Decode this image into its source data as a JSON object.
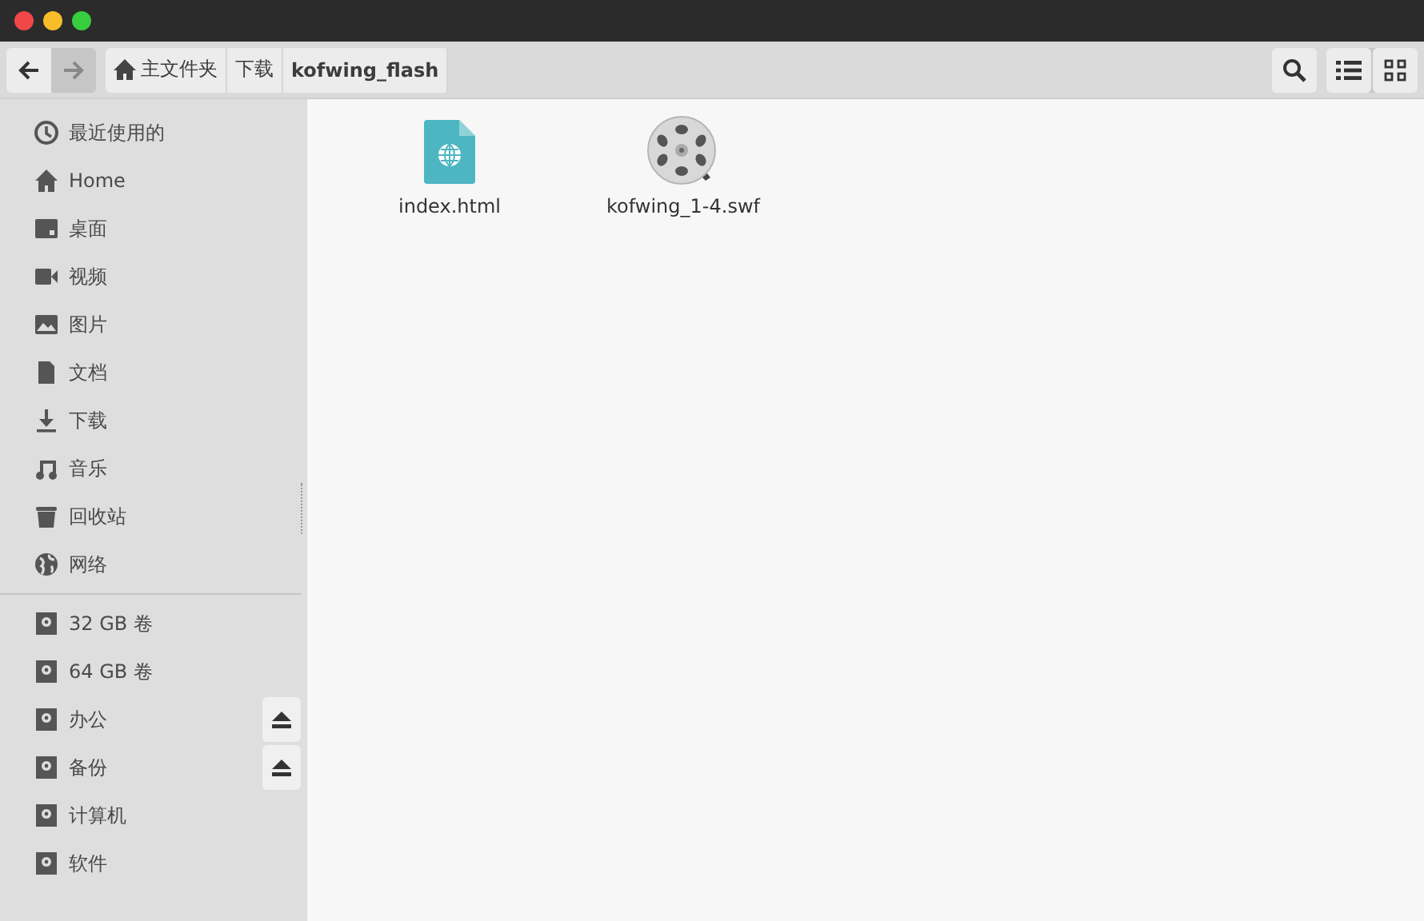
{
  "navigation": {
    "back": {
      "disabled": false
    },
    "forward": {
      "disabled": true
    }
  },
  "path": [
    {
      "label": "主文件夹",
      "kind": "home",
      "selected": false
    },
    {
      "label": "下载",
      "kind": "folder",
      "selected": false
    },
    {
      "label": "kofwing_flash",
      "kind": "folder",
      "selected": true
    }
  ],
  "sidebar": {
    "places": [
      {
        "label": "最近使用的",
        "kind": "recent"
      },
      {
        "label": "Home",
        "kind": "home"
      },
      {
        "label": "桌面",
        "kind": "desktop"
      },
      {
        "label": "视频",
        "kind": "video"
      },
      {
        "label": "图片",
        "kind": "pictures"
      },
      {
        "label": "文档",
        "kind": "documents"
      },
      {
        "label": "下载",
        "kind": "downloads"
      },
      {
        "label": "音乐",
        "kind": "music"
      },
      {
        "label": "回收站",
        "kind": "trash"
      },
      {
        "label": "网络",
        "kind": "network"
      }
    ],
    "devices": [
      {
        "label": "32 GB 卷",
        "ejectable": false
      },
      {
        "label": "64 GB 卷",
        "ejectable": false
      },
      {
        "label": "办公",
        "ejectable": true
      },
      {
        "label": "备份",
        "ejectable": true
      },
      {
        "label": "计算机",
        "ejectable": false
      },
      {
        "label": "软件",
        "ejectable": false
      }
    ]
  },
  "files": [
    {
      "name": "index.html",
      "kind": "html"
    },
    {
      "name": "kofwing_1-4.swf",
      "kind": "video"
    }
  ]
}
